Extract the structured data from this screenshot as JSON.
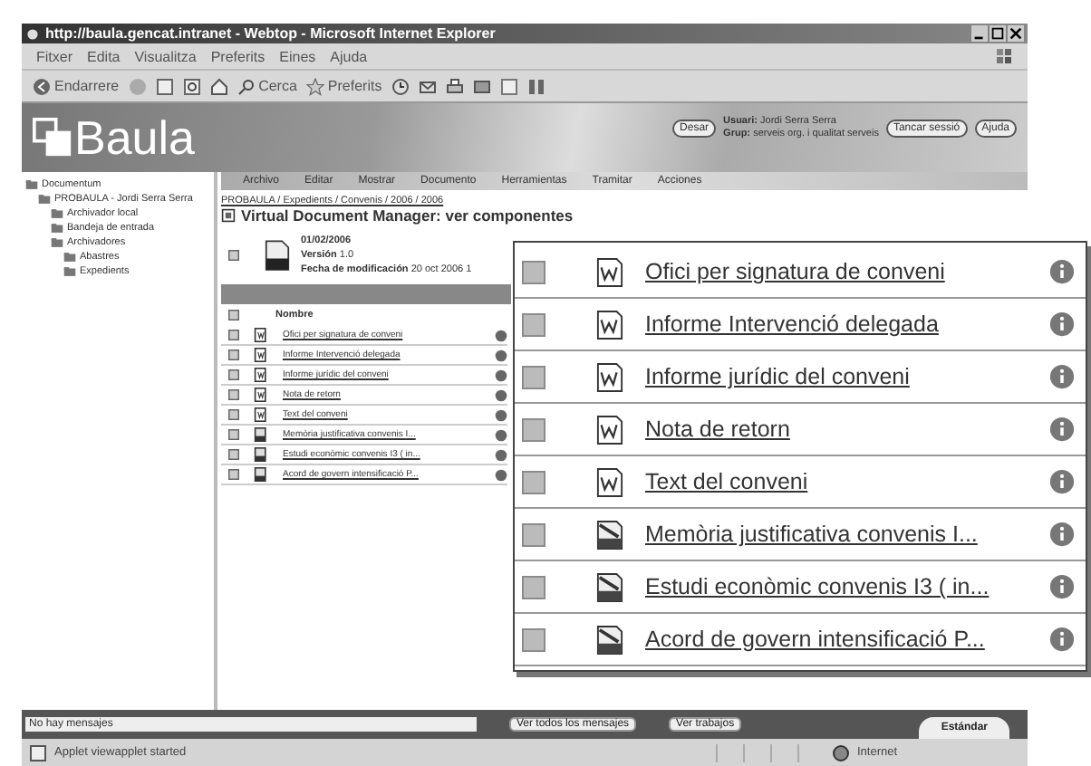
{
  "window": {
    "title": "http://baula.gencat.intranet - Webtop - Microsoft Internet Explorer"
  },
  "menu": [
    "Fitxer",
    "Edita",
    "Visualitza",
    "Preferits",
    "Eines",
    "Ajuda"
  ],
  "toolbar": {
    "back": "Endarrere",
    "search": "Cerca",
    "favorites": "Preferits"
  },
  "banner": {
    "logo": "Baula",
    "save": "Desar",
    "user_label": "Usuari:",
    "user": "Jordi Serra Serra",
    "group_label": "Grup:",
    "group": "serveis org. i qualitat serveis",
    "logout": "Tancar sessió",
    "help": "Ajuda"
  },
  "tree": [
    {
      "label": "Documentum",
      "children": [
        {
          "label": "PROBAULA - Jordi Serra Serra",
          "children": [
            {
              "label": "Archivador local"
            },
            {
              "label": "Bandeja de entrada"
            },
            {
              "label": "Archivadores",
              "children": [
                {
                  "label": "Abastres"
                },
                {
                  "label": "Expedients"
                }
              ]
            }
          ]
        }
      ]
    }
  ],
  "app_menu": [
    "Archivo",
    "Editar",
    "Mostrar",
    "Documento",
    "Herramientas",
    "Tramitar",
    "Acciones"
  ],
  "breadcrumb": "PROBAULA / Expedients / Convenis / 2006 / 2006",
  "page_title": "Virtual Document Manager: ver componentes",
  "document": {
    "name": "01/02/2006",
    "version_label": "Versión",
    "version": "1.0",
    "modified_label": "Fecha de modificación",
    "modified": "20 oct 2006 1",
    "checked": false
  },
  "table": {
    "column": "Nombre",
    "all_checked": false,
    "rows": [
      {
        "name": "Ofici per signatura de conveni",
        "kind": "word",
        "checked": false
      },
      {
        "name": "Informe Intervenció delegada",
        "kind": "word",
        "checked": false
      },
      {
        "name": "Informe jurídic del conveni",
        "kind": "word",
        "checked": false
      },
      {
        "name": "Nota de retorn",
        "kind": "word",
        "checked": false
      },
      {
        "name": "Text del conveni",
        "kind": "word",
        "checked": false
      },
      {
        "name": "Memòria justificativa convenis I...",
        "kind": "tiff",
        "checked": false
      },
      {
        "name": "Estudi econòmic convenis I3 ( in...",
        "kind": "tiff",
        "checked": false
      },
      {
        "name": "Acord de govern intensificació P...",
        "kind": "tiff",
        "checked": false
      }
    ]
  },
  "magnified": {
    "rows": [
      {
        "name": "Ofici per signatura de conveni",
        "kind": "word",
        "checked": false
      },
      {
        "name": "Informe Intervenció delegada",
        "kind": "word",
        "checked": false
      },
      {
        "name": "Informe jurídic del conveni",
        "kind": "word",
        "checked": false
      },
      {
        "name": "Nota de retorn",
        "kind": "word",
        "checked": false
      },
      {
        "name": "Text del conveni",
        "kind": "word",
        "checked": false
      },
      {
        "name": "Memòria justificativa convenis I...",
        "kind": "tiff",
        "checked": false
      },
      {
        "name": "Estudi econòmic convenis I3 ( in...",
        "kind": "tiff",
        "checked": false
      },
      {
        "name": "Acord de govern intensificació P...",
        "kind": "tiff",
        "checked": false
      }
    ]
  },
  "status": {
    "messages": "No hay mensajes",
    "all_messages": "Ver todos los mensajes",
    "jobs": "Ver trabajos",
    "tab": "Estándar"
  },
  "browser_status": {
    "text": "Applet viewapplet started",
    "zone": "Internet"
  }
}
